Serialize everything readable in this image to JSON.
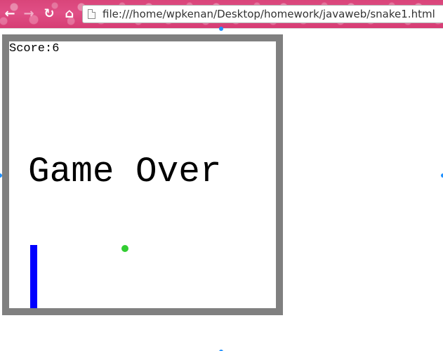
{
  "browser": {
    "url": "file:///home/wpkenan/Desktop/homework/javaweb/snake1.html",
    "back_icon": "back-arrow-icon",
    "forward_icon": "forward-arrow-icon",
    "reload_icon": "reload-icon",
    "home_icon": "home-icon",
    "page_icon": "page-icon"
  },
  "game": {
    "score_text": "Score:6",
    "game_over_text": "Game Over",
    "colors": {
      "border": "#808080",
      "snake": "#0000ff",
      "food": "#32cd32",
      "background": "#ffffff"
    },
    "grid_cells": 38,
    "snake_cells": [
      [
        3,
        29
      ],
      [
        3,
        30
      ],
      [
        3,
        31
      ],
      [
        3,
        32
      ],
      [
        3,
        33
      ],
      [
        3,
        34
      ],
      [
        3,
        35
      ],
      [
        3,
        36
      ],
      [
        3,
        37
      ]
    ],
    "food_cell": [
      16,
      29
    ]
  }
}
